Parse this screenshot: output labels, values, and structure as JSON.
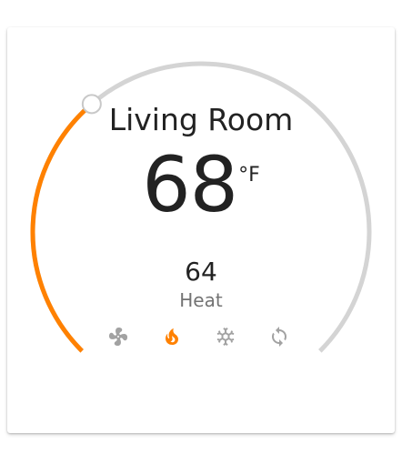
{
  "thermostat": {
    "room_name": "Living Room",
    "current_temperature": "68",
    "unit": "°F",
    "target_temperature": "64",
    "mode_label": "Heat",
    "range_min": 50,
    "range_max": 90
  },
  "modes": [
    {
      "name": "fan",
      "icon": "fan-icon",
      "active": false
    },
    {
      "name": "heat",
      "icon": "fire-icon",
      "active": true
    },
    {
      "name": "cool",
      "icon": "snowflake-icon",
      "active": false
    },
    {
      "name": "auto",
      "icon": "sync-icon",
      "active": false
    }
  ],
  "colors": {
    "heat_accent": "#ff8100",
    "track": "#d4d4d4",
    "inactive_icon": "#a2a2a2",
    "text": "#222222",
    "secondary_text": "#737373"
  }
}
